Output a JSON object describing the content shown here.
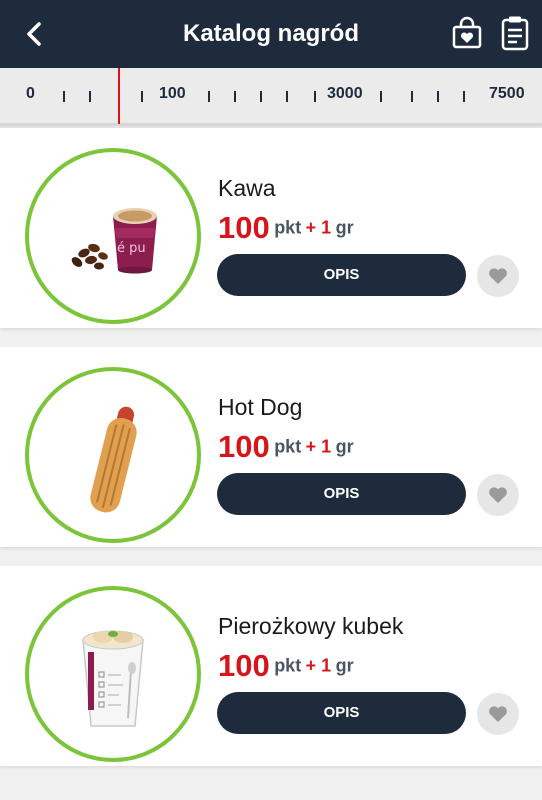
{
  "header": {
    "title": "Katalog nagród",
    "icons": [
      "back-arrow-icon",
      "shopping-bag-heart-icon",
      "clipboard-icon"
    ]
  },
  "ruler": {
    "labels": [
      "0",
      "100",
      "3000",
      "7500"
    ],
    "marker_color": "#d7141a"
  },
  "products": [
    {
      "name": "Kawa",
      "points": "100",
      "points_unit": "pkt",
      "plus": "+ 1",
      "extra_unit": "gr",
      "button": "OPIS"
    },
    {
      "name": "Hot Dog",
      "points": "100",
      "points_unit": "pkt",
      "plus": "+ 1",
      "extra_unit": "gr",
      "button": "OPIS"
    },
    {
      "name": "Pierożkowy kubek",
      "points": "100",
      "points_unit": "pkt",
      "plus": "+ 1",
      "extra_unit": "gr",
      "button": "OPIS"
    }
  ],
  "colors": {
    "navy": "#1d2b3d",
    "accent_red": "#d7141a",
    "ring_green": "#7cc43a"
  }
}
